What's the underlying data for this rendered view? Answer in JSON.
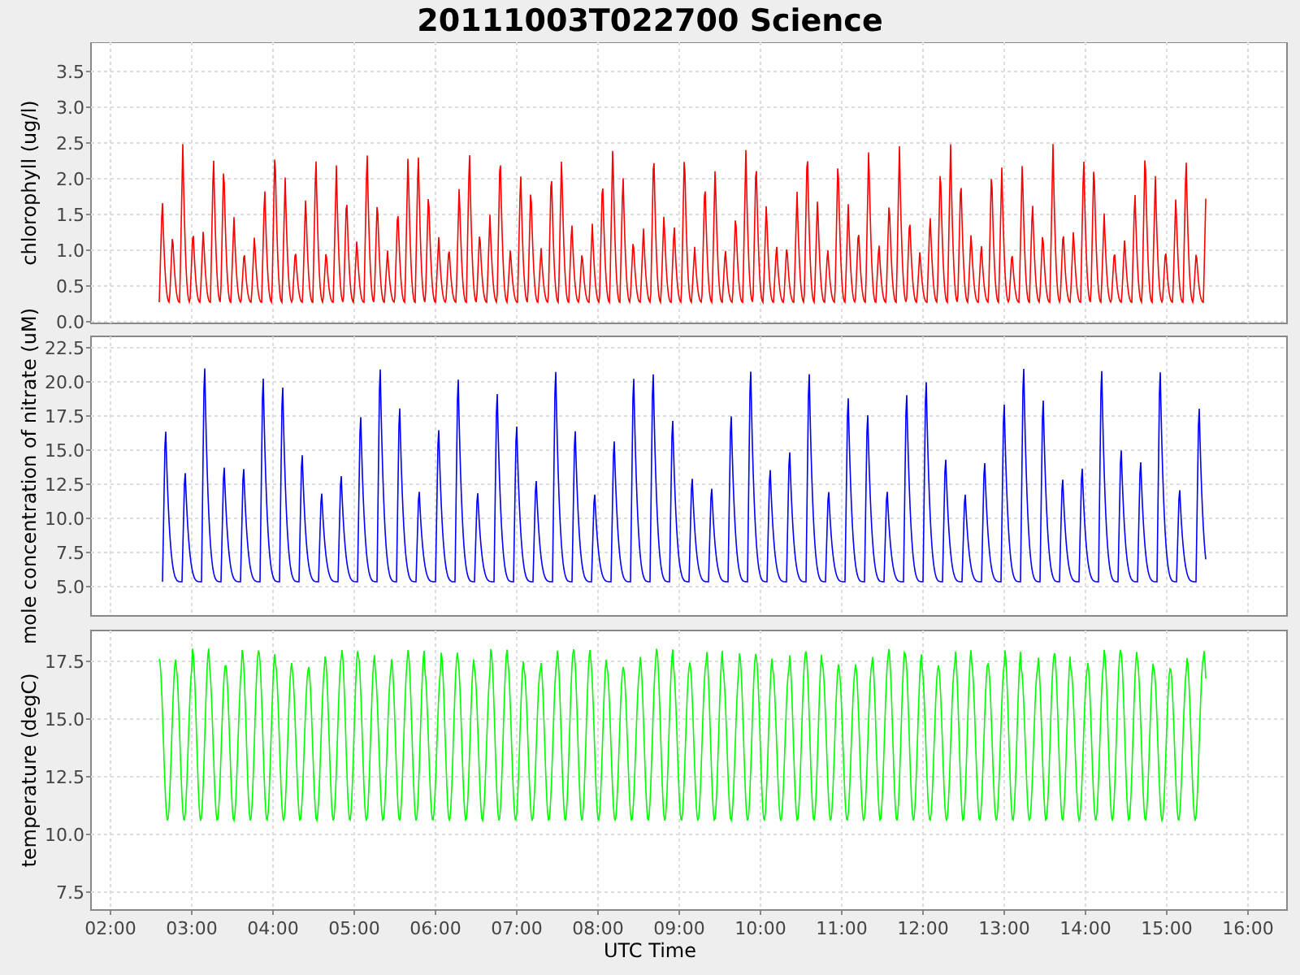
{
  "title": "20111003T022700 Science",
  "panels": [
    {
      "ylabel": "chlorophyll (ug/l)",
      "color": "#ff0000",
      "yticks": [
        "3.5",
        "3.0",
        "2.5",
        "2.0",
        "1.5",
        "1.0",
        "0.5",
        "0.0"
      ]
    },
    {
      "ylabel": "mole concentration of nitrate (uM)",
      "color": "#0000ff",
      "yticks": [
        "22.5",
        "20.0",
        "17.5",
        "15.0",
        "12.5",
        "10.0",
        "7.5",
        "5.0"
      ]
    },
    {
      "ylabel": "temperature (degC)",
      "color": "#00ff00",
      "yticks": [
        "17.5",
        "15.0",
        "12.5",
        "10.0",
        "7.5"
      ]
    }
  ],
  "xaxis": {
    "label": "UTC Time",
    "ticks": [
      "02:00",
      "03:00",
      "04:00",
      "05:00",
      "06:00",
      "07:00",
      "08:00",
      "09:00",
      "10:00",
      "11:00",
      "12:00",
      "13:00",
      "14:00",
      "15:00",
      "16:00"
    ]
  }
}
